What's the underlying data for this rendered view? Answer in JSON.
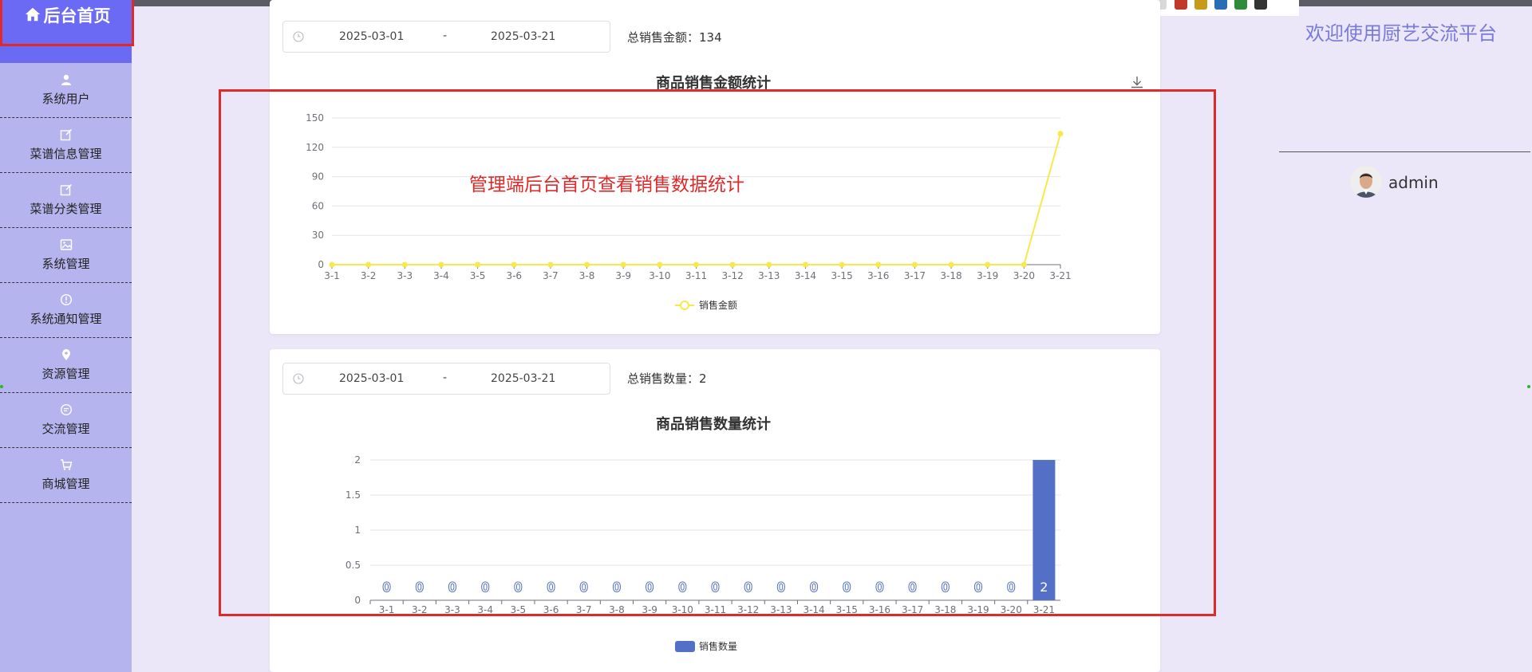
{
  "sidebar": {
    "home_label": "后台首页",
    "items": [
      {
        "label": "系统用户",
        "icon": "user-icon"
      },
      {
        "label": "菜谱信息管理",
        "icon": "edit-icon"
      },
      {
        "label": "菜谱分类管理",
        "icon": "edit-icon"
      },
      {
        "label": "系统管理",
        "icon": "image-icon"
      },
      {
        "label": "系统通知管理",
        "icon": "info-icon"
      },
      {
        "label": "资源管理",
        "icon": "location-icon"
      },
      {
        "label": "交流管理",
        "icon": "chat-icon"
      },
      {
        "label": "商城管理",
        "icon": "cart-icon"
      }
    ]
  },
  "header": {
    "welcome": "欢迎使用厨艺交流平台",
    "username": "admin"
  },
  "annotation": "管理端后台首页查看销售数据统计",
  "amount_panel": {
    "start_date": "2025-03-01",
    "separator": "-",
    "end_date": "2025-03-21",
    "total_label": "总销售金额：134"
  },
  "quantity_panel": {
    "start_date": "2025-03-01",
    "separator": "-",
    "end_date": "2025-03-21",
    "total_label": "总销售数量：2"
  },
  "chart_data": [
    {
      "type": "line",
      "title": "商品销售金额统计",
      "categories": [
        "3-1",
        "3-2",
        "3-3",
        "3-4",
        "3-5",
        "3-6",
        "3-7",
        "3-8",
        "3-9",
        "3-10",
        "3-11",
        "3-12",
        "3-13",
        "3-14",
        "3-15",
        "3-16",
        "3-17",
        "3-18",
        "3-19",
        "3-20",
        "3-21"
      ],
      "series": [
        {
          "name": "销售金额",
          "values": [
            0,
            0,
            0,
            0,
            0,
            0,
            0,
            0,
            0,
            0,
            0,
            0,
            0,
            0,
            0,
            0,
            0,
            0,
            0,
            0,
            134
          ],
          "color": "#f7e94b"
        }
      ],
      "yticks": [
        0,
        30,
        60,
        90,
        120,
        150
      ],
      "ylim": [
        0,
        150
      ],
      "legend": "bottom-center",
      "grid": true
    },
    {
      "type": "bar",
      "title": "商品销售数量统计",
      "categories": [
        "3-1",
        "3-2",
        "3-3",
        "3-4",
        "3-5",
        "3-6",
        "3-7",
        "3-8",
        "3-9",
        "3-10",
        "3-11",
        "3-12",
        "3-13",
        "3-14",
        "3-15",
        "3-16",
        "3-17",
        "3-18",
        "3-19",
        "3-20",
        "3-21"
      ],
      "series": [
        {
          "name": "销售数量",
          "values": [
            0,
            0,
            0,
            0,
            0,
            0,
            0,
            0,
            0,
            0,
            0,
            0,
            0,
            0,
            0,
            0,
            0,
            0,
            0,
            0,
            2
          ],
          "color": "#5470c6"
        }
      ],
      "yticks": [
        0,
        0.5,
        1,
        1.5,
        2
      ],
      "ylim": [
        0,
        2
      ],
      "legend": "bottom-center",
      "grid": true,
      "data_labels": true
    }
  ],
  "colors": {
    "sidebar_bg": "#b6b4ee",
    "home_bg": "#6a6af4",
    "page_bg": "#ebe7f8",
    "annotation_red": "#e02a2a",
    "welcome_text": "#7a7ad8"
  }
}
